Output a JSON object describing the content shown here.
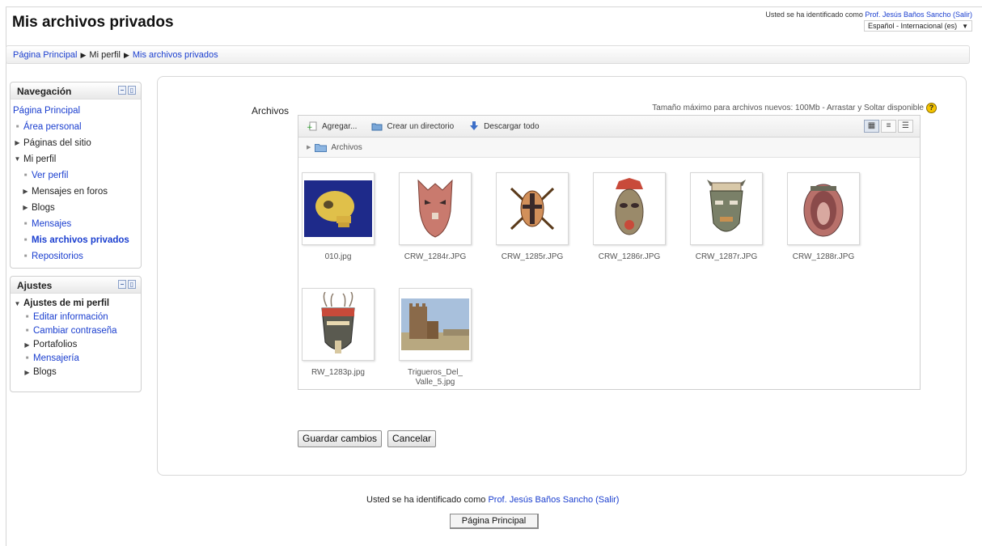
{
  "page_title": "Mis archivos privados",
  "header": {
    "login_prefix": "Usted se ha identificado como",
    "user_name": "Prof. Jesús Baños Sancho",
    "logout": "(Salir)",
    "language": "Español - Internacional (es)"
  },
  "breadcrumb": [
    "Página Principal",
    "Mi perfil",
    "Mis archivos privados"
  ],
  "navigation": {
    "title": "Navegación",
    "items": [
      {
        "label": "Página Principal"
      },
      {
        "label": "Área personal"
      },
      {
        "label": "Páginas del sitio"
      },
      {
        "label": "Mi perfil"
      },
      {
        "label": "Ver perfil"
      },
      {
        "label": "Mensajes en foros"
      },
      {
        "label": "Blogs"
      },
      {
        "label": "Mensajes"
      },
      {
        "label": "Mis archivos privados"
      },
      {
        "label": "Repositorios"
      }
    ]
  },
  "settings": {
    "title": "Ajustes",
    "items": [
      {
        "label": "Ajustes de mi perfil"
      },
      {
        "label": "Editar información"
      },
      {
        "label": "Cambiar contraseña"
      },
      {
        "label": "Portafolios"
      },
      {
        "label": "Mensajería"
      },
      {
        "label": "Blogs"
      }
    ]
  },
  "filemanager": {
    "label": "Archivos",
    "max_size": "Tamaño máximo para archivos nuevos: 100Mb - Arrastar y Soltar disponible",
    "add": "Agregar...",
    "mkdir": "Crear un directorio",
    "download_all": "Descargar todo",
    "path": "Archivos",
    "files": [
      {
        "name": "010.jpg"
      },
      {
        "name": "CRW_1284r.JPG"
      },
      {
        "name": "CRW_1285r.JPG"
      },
      {
        "name": "CRW_1286r.JPG"
      },
      {
        "name": "CRW_1287r.JPG"
      },
      {
        "name": "CRW_1288r.JPG"
      },
      {
        "name": "RW_1283p.jpg"
      },
      {
        "name": "Trigueros_Del_Valle_5.jpg"
      }
    ]
  },
  "buttons": {
    "save": "Guardar cambios",
    "cancel": "Cancelar",
    "home": "Página Principal"
  },
  "colors": {
    "link": "#1a3ecf",
    "help_icon": "#f5c400"
  }
}
